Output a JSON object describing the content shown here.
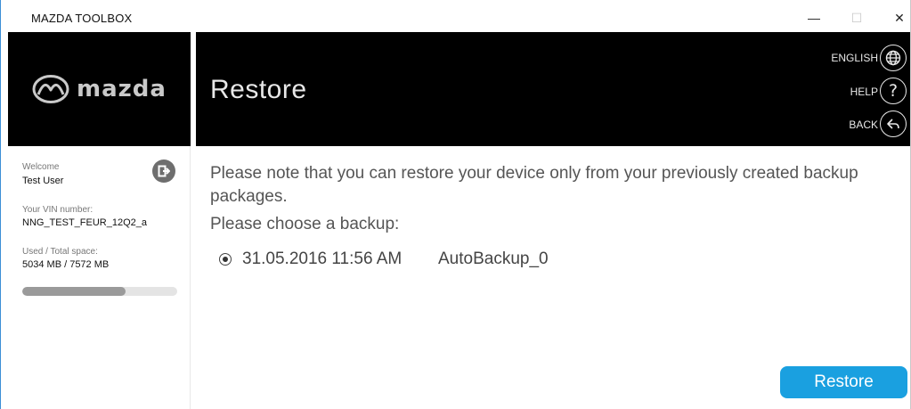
{
  "window": {
    "title": "MAZDA TOOLBOX",
    "minimize": "—",
    "maximize": "☐",
    "close": "✕"
  },
  "brand": {
    "wordmark": "mazda",
    "logo_icon": "mazda-logo-icon"
  },
  "sidebar": {
    "welcome_label": "Welcome",
    "user_name": "Test User",
    "vin_label": "Your VIN number:",
    "vin_value": "NNG_TEST_FEUR_12Q2_a",
    "space_label": "Used / Total space:",
    "space_value": "5034 MB / 7572 MB",
    "space_used_fraction": 0.665,
    "logout_icon": "logout-icon"
  },
  "header": {
    "page_title": "Restore",
    "language_label": "ENGLISH",
    "help_label": "HELP",
    "back_label": "BACK",
    "icons": [
      "globe-icon",
      "help-icon",
      "back-icon"
    ]
  },
  "main": {
    "note": "Please note that you can restore your device only from your previously created backup packages.",
    "choose_label": "Please choose a backup:",
    "backups": [
      {
        "date": "31.05.2016 11:56 AM",
        "name": "AutoBackup_0",
        "selected": true
      }
    ],
    "restore_button": "Restore"
  },
  "colors": {
    "header_bg": "#000000",
    "accent": "#1aa0e0",
    "text_muted": "#555555"
  }
}
